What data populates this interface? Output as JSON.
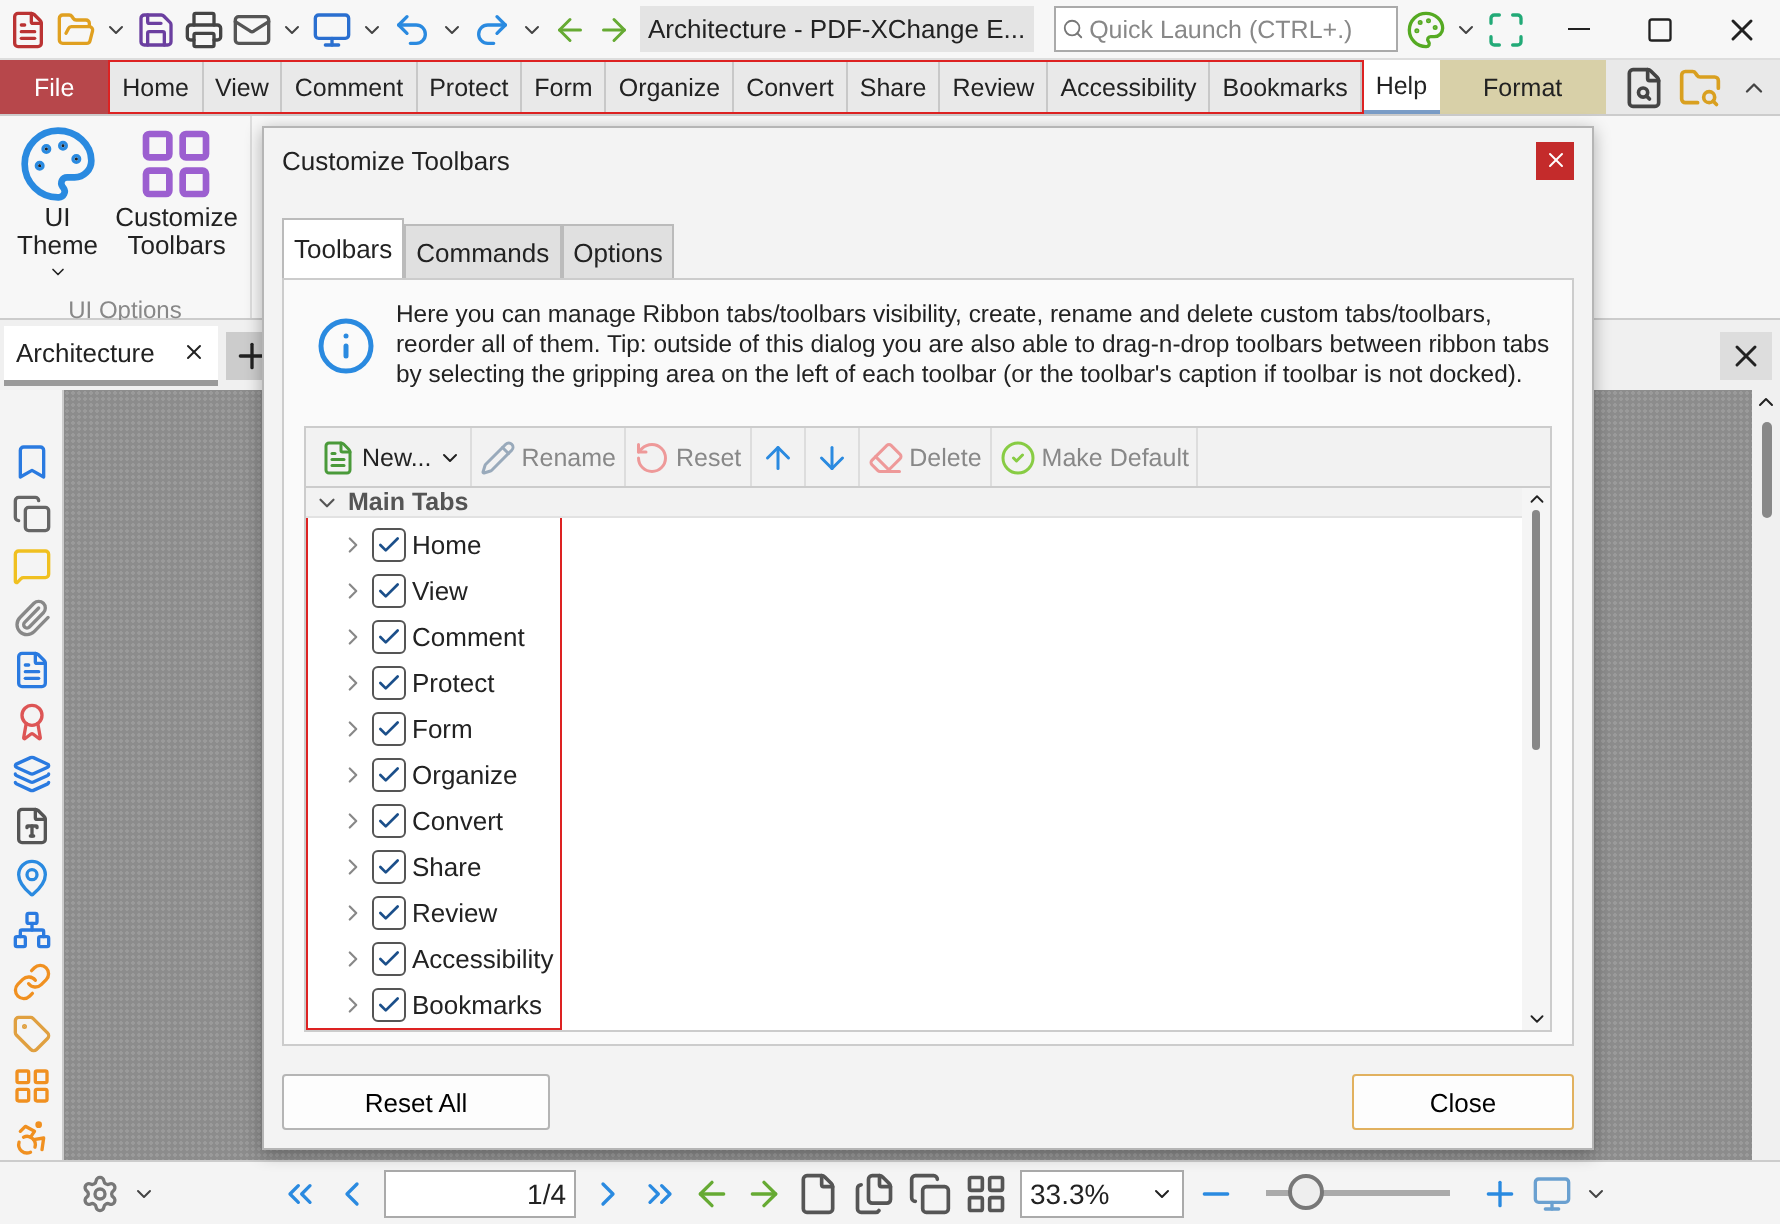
{
  "window": {
    "title": "Architecture - PDF-XChange E..."
  },
  "quick_launch": {
    "placeholder": "Quick Launch (CTRL+.)"
  },
  "ribbon_tabs": [
    {
      "label": "File",
      "kind": "file",
      "selected": false
    },
    {
      "label": "Home",
      "kind": "normal",
      "selected": false
    },
    {
      "label": "View",
      "kind": "normal",
      "selected": false
    },
    {
      "label": "Comment",
      "kind": "normal",
      "selected": false
    },
    {
      "label": "Protect",
      "kind": "normal",
      "selected": false
    },
    {
      "label": "Form",
      "kind": "normal",
      "selected": false
    },
    {
      "label": "Organize",
      "kind": "normal",
      "selected": false
    },
    {
      "label": "Convert",
      "kind": "normal",
      "selected": false
    },
    {
      "label": "Share",
      "kind": "normal",
      "selected": false
    },
    {
      "label": "Review",
      "kind": "normal",
      "selected": false
    },
    {
      "label": "Accessibility",
      "kind": "normal",
      "selected": false
    },
    {
      "label": "Bookmarks",
      "kind": "normal",
      "selected": false
    },
    {
      "label": "Help",
      "kind": "normal",
      "selected": true
    },
    {
      "label": "Format",
      "kind": "contextual",
      "selected": false
    }
  ],
  "ribbon": {
    "buttons": [
      {
        "label": "UI",
        "label2": "Theme",
        "dropdown": true
      },
      {
        "label": "Customize",
        "label2": "Toolbars",
        "dropdown": false
      }
    ],
    "group_label": "UI Options"
  },
  "document_tabs": [
    {
      "label": "Architecture",
      "selected": true
    }
  ],
  "dialog": {
    "title": "Customize Toolbars",
    "tabs": [
      {
        "label": "Toolbars",
        "selected": true
      },
      {
        "label": "Commands",
        "selected": false
      },
      {
        "label": "Options",
        "selected": false
      }
    ],
    "info": "Here you can manage Ribbon tabs/toolbars visibility, create, rename and delete custom tabs/toolbars, reorder all of them. Tip: outside of this dialog you are also able to drag-n-drop toolbars between ribbon tabs by selecting the gripping area on the left of each toolbar (or the toolbar's caption if toolbar is not docked).",
    "toolbar": [
      {
        "label": "New...",
        "kind": "new",
        "disabled": false
      },
      {
        "label": "Rename",
        "kind": "rename",
        "disabled": true
      },
      {
        "label": "Reset",
        "kind": "reset",
        "disabled": true
      },
      {
        "kind": "up",
        "disabled": false
      },
      {
        "kind": "down",
        "disabled": false
      },
      {
        "label": "Delete",
        "kind": "delete",
        "disabled": true
      },
      {
        "label": "Make Default",
        "kind": "default",
        "disabled": true
      }
    ],
    "tree": {
      "label": "Main Tabs",
      "expanded": true,
      "children": [
        {
          "label": "Home",
          "checked": true,
          "expanded": false
        },
        {
          "label": "View",
          "checked": true,
          "expanded": false
        },
        {
          "label": "Comment",
          "checked": true,
          "expanded": false
        },
        {
          "label": "Protect",
          "checked": true,
          "expanded": false
        },
        {
          "label": "Form",
          "checked": true,
          "expanded": false
        },
        {
          "label": "Organize",
          "checked": true,
          "expanded": false
        },
        {
          "label": "Convert",
          "checked": true,
          "expanded": false
        },
        {
          "label": "Share",
          "checked": true,
          "expanded": false
        },
        {
          "label": "Review",
          "checked": true,
          "expanded": false
        },
        {
          "label": "Accessibility",
          "checked": true,
          "expanded": false
        },
        {
          "label": "Bookmarks",
          "checked": true,
          "expanded": false
        }
      ]
    },
    "buttons": [
      {
        "label": "Reset All",
        "kind": "left"
      },
      {
        "label": "Close",
        "kind": "default"
      }
    ]
  },
  "status_bar": {
    "page": "1/4",
    "zoom": "33.3%",
    "zoom_slider": {
      "level": 0.22
    }
  }
}
